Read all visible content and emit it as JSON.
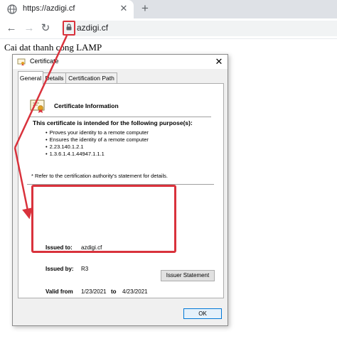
{
  "browser": {
    "tab_title": "https://azdigi.cf",
    "tab_close": "✕",
    "new_tab": "+",
    "back": "←",
    "forward": "→",
    "reload": "↻",
    "url": "azdigi.cf"
  },
  "page": {
    "heading": "Cai dat thanh cong LAMP"
  },
  "dialog": {
    "title": "Certificate",
    "close": "✕",
    "tabs": [
      "General",
      "Details",
      "Certification Path"
    ],
    "info_title": "Certificate Information",
    "purpose_title": "This certificate is intended for the following purpose(s):",
    "purposes": [
      "Proves your identity to a remote computer",
      "Ensures the identity of a remote computer",
      "2.23.140.1.2.1",
      "1.3.6.1.4.1.44947.1.1.1"
    ],
    "refer_note": "* Refer to the certification authority's statement for details.",
    "issued_to_label": "Issued to:",
    "issued_to_value": "azdigi.cf",
    "issued_by_label": "Issued by:",
    "issued_by_value": "R3",
    "valid_from_label": "Valid from",
    "valid_from_value": "1/23/2021",
    "valid_to_label": "to",
    "valid_to_value": "4/23/2021",
    "issuer_statement_button": "Issuer Statement",
    "ok_button": "OK"
  },
  "colors": {
    "annotation_red": "#d9323c",
    "ok_border": "#0078d7"
  },
  "icons": [
    "globe-icon",
    "lock-icon",
    "certificate-icon"
  ]
}
